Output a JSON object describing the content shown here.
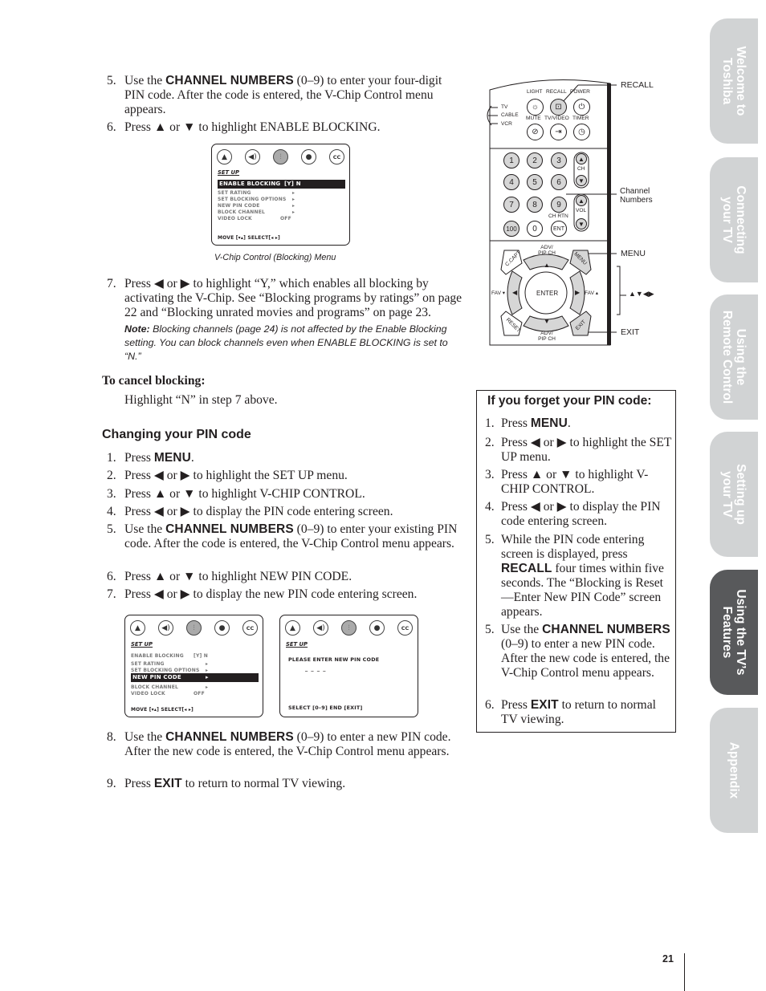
{
  "top_steps": [
    {
      "num": "5.",
      "pre": "Use the ",
      "kw": "CHANNEL NUMBERS",
      "post": " (0–9) to enter your four-digit PIN code. After the code is entered, the V-Chip Control menu appears."
    },
    {
      "num": "6.",
      "text": "Press ▲ or ▼ to highlight ENABLE BLOCKING."
    }
  ],
  "menu_blocking": {
    "title": "SET UP",
    "rows": [
      {
        "label": "ENABLE BLOCKING",
        "value": "[Y] N",
        "highlighted": true
      },
      {
        "label": "SET RATING",
        "value": "▸"
      },
      {
        "label": "SET BLOCKING OPTIONS",
        "value": "▸"
      },
      {
        "label": "NEW PIN CODE",
        "value": "▸"
      },
      {
        "label": "BLOCK CHANNEL",
        "value": "▸"
      },
      {
        "label": "VIDEO LOCK",
        "value": "OFF"
      }
    ],
    "footer": "MOVE [▾▴]    SELECT[◂ ▸]",
    "caption": "V-Chip Control (Blocking) Menu"
  },
  "step7": {
    "num": "7.",
    "text": "Press ◀ or ▶ to highlight “Y,” which enables all blocking by activating the V-Chip. See “Blocking programs by ratings” on page 22 and “Blocking unrated movies and programs” on page 23."
  },
  "note": {
    "label": "Note:",
    "text": " Blocking channels (page 24) is not affected by the Enable Blocking setting. You can block channels even when ENABLE BLOCKING is set to “N.”"
  },
  "cancel": {
    "heading": "To cancel blocking:",
    "text": "Highlight “N” in step 7 above."
  },
  "changing": {
    "heading": "Changing your PIN code",
    "steps": [
      {
        "num": "1.",
        "pre": "Press ",
        "kw": "MENU",
        "post": "."
      },
      {
        "num": "2.",
        "text": "Press ◀ or ▶ to highlight the SET UP menu."
      },
      {
        "num": "3.",
        "text": "Press ▲ or ▼ to highlight V-CHIP CONTROL."
      },
      {
        "num": "4.",
        "text": "Press ◀ or ▶ to display the PIN code entering screen."
      },
      {
        "num": "5.",
        "pre": "Use the ",
        "kw": "CHANNEL NUMBERS",
        "post": " (0–9) to enter your existing PIN code. After the code is entered, the V-Chip Control menu appears."
      },
      {
        "num": "6.",
        "text": "Press ▲ or ▼ to highlight NEW PIN CODE."
      },
      {
        "num": "7.",
        "text": "Press ◀ or ▶ to display the new PIN code entering screen."
      }
    ]
  },
  "menu_newpin": {
    "title": "SET UP",
    "rows": [
      {
        "label": "ENABLE BLOCKING",
        "value": "[Y] N"
      },
      {
        "label": "SET RATING",
        "value": "▸"
      },
      {
        "label": "SET BLOCKING OPTIONS",
        "value": "▸"
      },
      {
        "label": "NEW PIN CODE",
        "value": "▸",
        "highlighted": true
      },
      {
        "label": "BLOCK CHANNEL",
        "value": "▸"
      },
      {
        "label": "VIDEO LOCK",
        "value": "OFF"
      }
    ],
    "footer": "MOVE [▾▴]    SELECT[◂ ▸]"
  },
  "menu_pinentry": {
    "title": "SET UP",
    "prompt": "PLEASE ENTER NEW PIN CODE",
    "dashes": "_ _ _ _",
    "footer": "SELECT [0–9]   END [EXIT]"
  },
  "bottom_steps": [
    {
      "num": "8.",
      "pre": "Use the ",
      "kw": "CHANNEL NUMBERS",
      "post": " (0–9) to enter a new PIN code. After the new code is entered, the V-Chip Control menu appears."
    },
    {
      "num": "9.",
      "pre": "Press ",
      "kw": "EXIT",
      "post": " to return to normal TV viewing."
    }
  ],
  "remote": {
    "mode_labels": [
      "TV",
      "CABLE",
      "VCR"
    ],
    "top_labels": [
      "LIGHT",
      "RECALL",
      "POWER",
      "MUTE",
      "TV/VIDEO",
      "TIMER"
    ],
    "number_keys": [
      "1",
      "2",
      "3",
      "4",
      "5",
      "6",
      "7",
      "8",
      "9",
      "100",
      "0",
      "ENT"
    ],
    "ch_label": "CH",
    "vol_label": "VOL",
    "chrtn_label": "CH RTN",
    "adv_label": "ADV/ PIP CH",
    "ccapt": "C.CAPT",
    "menu_key": "MENU",
    "reset_key": "RESET",
    "exit_key": "EXIT",
    "enter_key": "ENTER",
    "fav_left": "FAV ▾",
    "fav_right": "FAV ▴",
    "callouts": {
      "recall": "RECALL",
      "channel_numbers_1": "Channel",
      "channel_numbers_2": "Numbers",
      "menu": "MENU",
      "arrows": "▲▼◀▶",
      "exit": "EXIT"
    }
  },
  "forget_box": {
    "title": "If you forget your PIN code:",
    "steps": [
      {
        "num": "1.",
        "pre": "Press ",
        "kw": "MENU",
        "post": "."
      },
      {
        "num": "2.",
        "text": "Press ◀ or ▶ to highlight the SET UP menu."
      },
      {
        "num": "3.",
        "text": "Press ▲ or ▼ to highlight V-CHIP CONTROL."
      },
      {
        "num": "4.",
        "text": "Press ◀ or ▶ to display the PIN code entering screen."
      },
      {
        "num": "5.",
        "pre": "While the PIN code entering screen is displayed, press ",
        "kw": "RECALL",
        "post": " four times within five seconds. The “Blocking is Reset—Enter New PIN Code” screen appears."
      },
      {
        "num": "5.",
        "pre": "Use the ",
        "kw": "CHANNEL NUMBERS",
        "post": " (0–9) to enter a new PIN code. After the new code is entered, the V-Chip Control menu appears."
      },
      {
        "num": "6.",
        "pre": "Press ",
        "kw": "EXIT",
        "post": " to return to normal TV viewing."
      }
    ]
  },
  "side_tabs": [
    {
      "label_1": "Welcome to",
      "label_2": "Toshiba",
      "active": false
    },
    {
      "label_1": "Connecting",
      "label_2": "your TV",
      "active": false
    },
    {
      "label_1": "Using the",
      "label_2": "Remote Control",
      "active": false
    },
    {
      "label_1": "Setting up",
      "label_2": "your TV",
      "active": false
    },
    {
      "label_1": "Using the TV’s",
      "label_2": "Features",
      "active": true
    },
    {
      "label_1": "Appendix",
      "label_2": "",
      "active": false
    }
  ],
  "colors": {
    "tab_inactive": "#d1d3d4",
    "tab_active": "#58595b",
    "text": "#231f20"
  },
  "page_number": "21"
}
